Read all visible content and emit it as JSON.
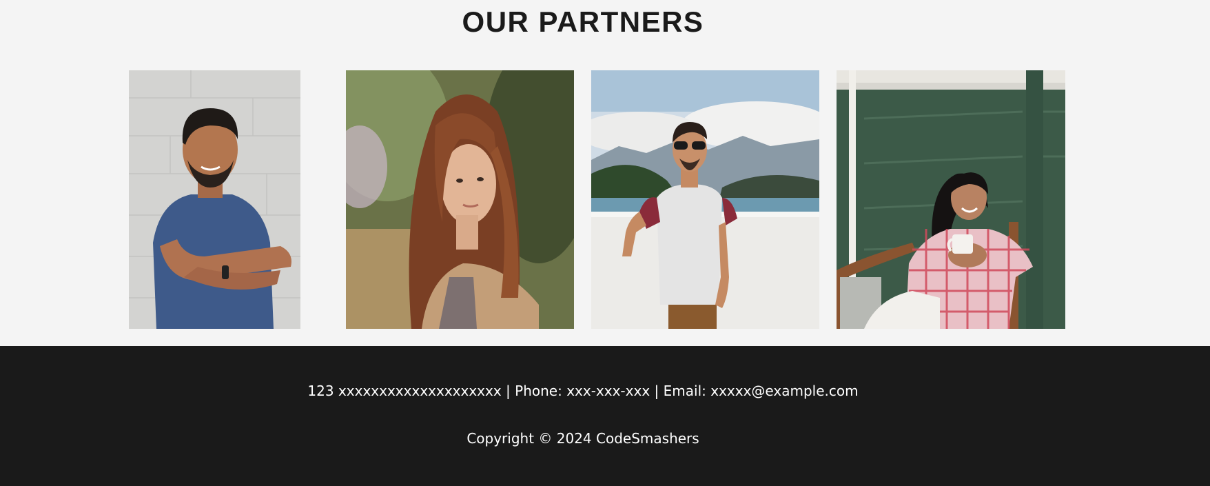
{
  "partners": {
    "title": "OUR PARTNERS",
    "photos": [
      {
        "icon": "partner-photo-man-blue-shirt"
      },
      {
        "icon": "partner-photo-woman-long-hair"
      },
      {
        "icon": "partner-photo-man-sunglasses"
      },
      {
        "icon": "partner-photo-woman-chair-mug"
      }
    ]
  },
  "footer": {
    "address": "123 xxxxxxxxxxxxxxxxxxxx",
    "phone_label": "Phone:",
    "phone": "xxx-xxx-xxx",
    "email_label": "Email:",
    "email": "xxxxx@example.com",
    "separator": "|",
    "copyright": "Copyright © 2024 CodeSmashers"
  },
  "colors": {
    "page_bg": "#f4f4f4",
    "footer_bg": "#1a1a1a",
    "title": "#1a1a1a",
    "footer_text": "#ffffff"
  }
}
